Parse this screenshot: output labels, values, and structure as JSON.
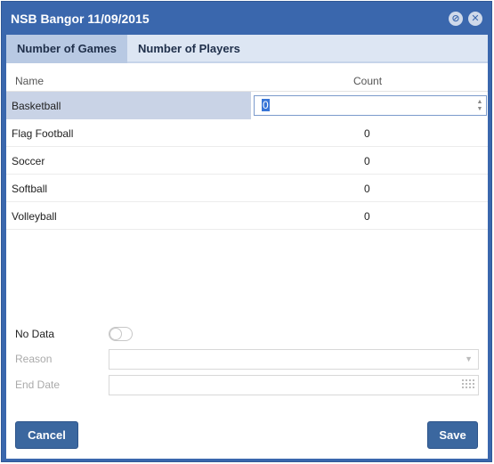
{
  "window": {
    "title": "NSB Bangor 11/09/2015"
  },
  "tabs": [
    {
      "label": "Number of Games"
    },
    {
      "label": "Number of Players"
    }
  ],
  "grid": {
    "headers": {
      "name": "Name",
      "count": "Count"
    },
    "rows": [
      {
        "name": "Basketball",
        "count": "0"
      },
      {
        "name": "Flag Football",
        "count": "0"
      },
      {
        "name": "Soccer",
        "count": "0"
      },
      {
        "name": "Softball",
        "count": "0"
      },
      {
        "name": "Volleyball",
        "count": "0"
      }
    ]
  },
  "form": {
    "no_data_label": "No Data",
    "reason_label": "Reason",
    "reason_value": "",
    "end_date_label": "End Date",
    "end_date_value": ""
  },
  "buttons": {
    "cancel": "Cancel",
    "save": "Save"
  },
  "colors": {
    "titlebar": "#3a67ad",
    "active_tab": "#b8c9e3",
    "selected_row": "#c9d3e6",
    "button": "#3b679f"
  }
}
